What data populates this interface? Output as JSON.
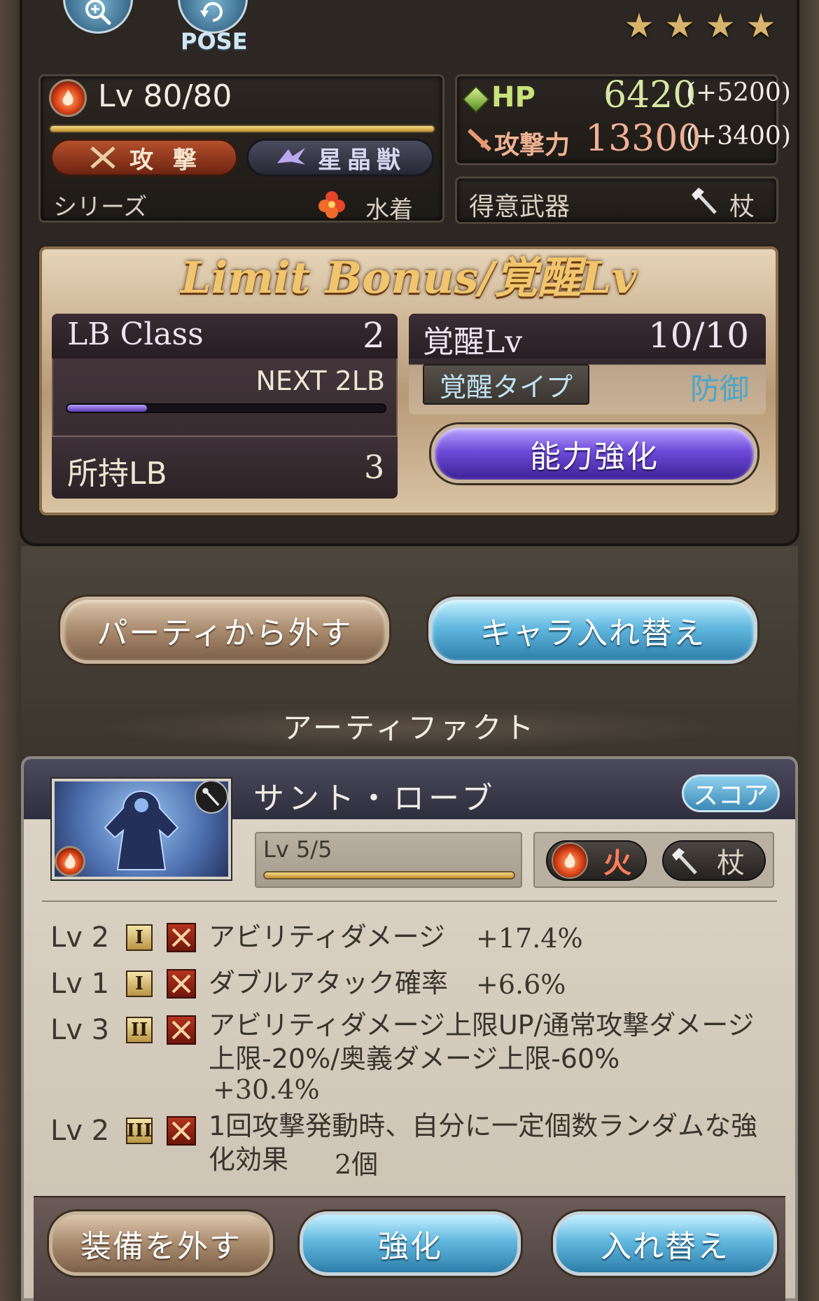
{
  "top": {
    "pose_label": "POSE",
    "stars": [
      "★",
      "★",
      "★",
      "★"
    ]
  },
  "character": {
    "level": "Lv 80/80",
    "type_label": "攻 撃",
    "race_label": "星晶獣",
    "series_label": "シリーズ",
    "series_value": "水着",
    "hp_label": "HP",
    "hp_value": "6420",
    "hp_bonus": "(+5200)",
    "atk_label": "攻撃力",
    "atk_value": "13300",
    "atk_bonus": "(+3400)",
    "weapon_label": "得意武器",
    "weapon_value": "杖"
  },
  "limit_bonus": {
    "title": "Limit Bonus/覚醒Lv",
    "class_label": "LB Class",
    "class_value": "2",
    "next_label": "NEXT 2LB",
    "next_progress": 0.25,
    "owned_label": "所持LB",
    "owned_value": "3",
    "awake_label": "覚醒Lv",
    "awake_value": "10/10",
    "awake_type_label": "覚醒タイプ",
    "awake_type_value": "防御",
    "power_button": "能力強化"
  },
  "actions": {
    "remove_party": "パーティから外す",
    "swap_chara": "キャラ入れ替え"
  },
  "artifact": {
    "heading": "アーティファクト",
    "name": "サント・ローブ",
    "score_button": "スコア",
    "level": "Lv 5/5",
    "element_tag": "火",
    "weapon_tag": "杖",
    "skills": [
      {
        "lv": "Lv 2",
        "tier": "I",
        "text": "アビリティダメージ",
        "value": "+17.4%"
      },
      {
        "lv": "Lv 1",
        "tier": "I",
        "text": "ダブルアタック確率",
        "value": "+6.6%"
      },
      {
        "lv": "Lv 3",
        "tier": "II",
        "text": "アビリティダメージ上限UP/通常攻撃ダメージ上限-20%/奥義ダメージ上限-60%",
        "value": "+30.4%"
      },
      {
        "lv": "Lv 2",
        "tier": "III",
        "text": "1回攻撃発動時、自分に一定個数ランダムな強化効果",
        "value": "2個"
      }
    ]
  },
  "bottom": {
    "unequip": "装備を外す",
    "enhance": "強化",
    "replace": "入れ替え"
  },
  "colors": {
    "accent_purple": "#6e4bd9",
    "accent_blue": "#62b9e0",
    "fire": "#e24b1c"
  }
}
